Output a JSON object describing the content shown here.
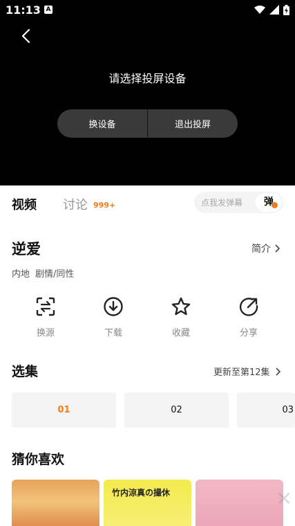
{
  "status_bar": {
    "time": "11:13",
    "a_badge": "A"
  },
  "cast": {
    "title": "请选择投屏设备",
    "switch_label": "换设备",
    "exit_label": "退出投屏"
  },
  "tabs": {
    "video": "视频",
    "discuss": "讨论",
    "discuss_count": "999+"
  },
  "danmaku": {
    "placeholder": "点我发弹幕",
    "toggle": "弹"
  },
  "show": {
    "title": "逆爱",
    "intro_label": "简介",
    "region": "内地",
    "genre": "剧情/同性"
  },
  "actions": [
    {
      "label": "换源",
      "icon": "switch-source-icon"
    },
    {
      "label": "下载",
      "icon": "download-icon"
    },
    {
      "label": "收藏",
      "icon": "star-icon"
    },
    {
      "label": "分享",
      "icon": "share-icon"
    }
  ],
  "episodes": {
    "title": "选集",
    "update": "更新至第12集",
    "items": [
      "01",
      "02",
      "03"
    ],
    "selected": "01"
  },
  "recommend": {
    "title": "猜你喜欢",
    "poster2_text": "竹内涼真の撮休"
  },
  "colors": {
    "accent": "#f07d1a",
    "dark_bg": "#000000"
  }
}
